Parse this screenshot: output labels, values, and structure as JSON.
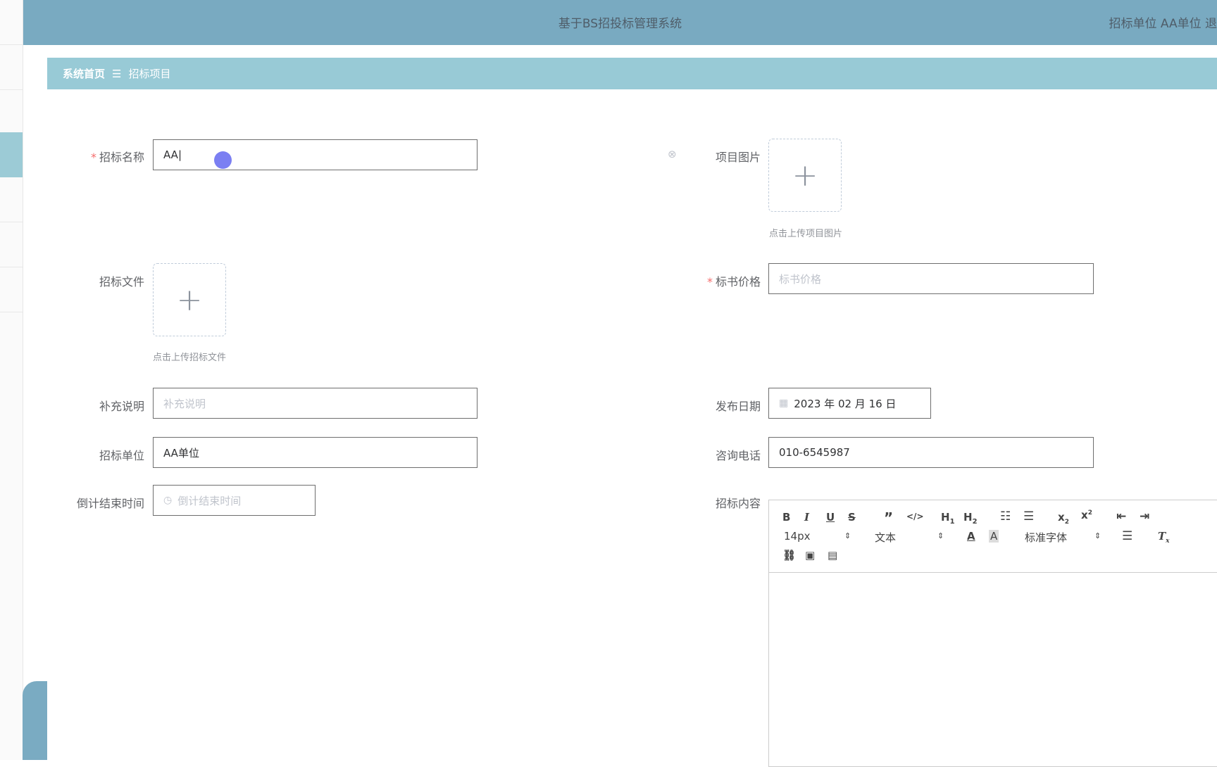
{
  "header": {
    "title": "基于BS招投标管理系统",
    "user": "招标单位 AA单位  退"
  },
  "breadcrumb": {
    "home": "系统首页",
    "separator": "☰",
    "current": "招标项目"
  },
  "form": {
    "name": {
      "label": "招标名称",
      "value": "AA"
    },
    "image": {
      "label": "项目图片",
      "tip": "点击上传项目图片"
    },
    "file": {
      "label": "招标文件",
      "tip": "点击上传招标文件"
    },
    "price": {
      "label": "标书价格",
      "placeholder": "标书价格"
    },
    "note": {
      "label": "补充说明",
      "placeholder": "补充说明"
    },
    "date": {
      "label": "发布日期",
      "value": "2023 年 02 月 16 日"
    },
    "unit": {
      "label": "招标单位",
      "value": "AA单位"
    },
    "phone": {
      "label": "咨询电话",
      "value": "010-6545987"
    },
    "countdown": {
      "label": "倒计结束时间",
      "placeholder": "倒计结束时间"
    },
    "content": {
      "label": "招标内容"
    }
  },
  "editor": {
    "font_size": "14px",
    "header": "文本",
    "font": "标准字体"
  },
  "colors": {
    "header_bg": "#79aac1",
    "crumb_bg": "#98cad6",
    "required": "#f56c6c"
  }
}
